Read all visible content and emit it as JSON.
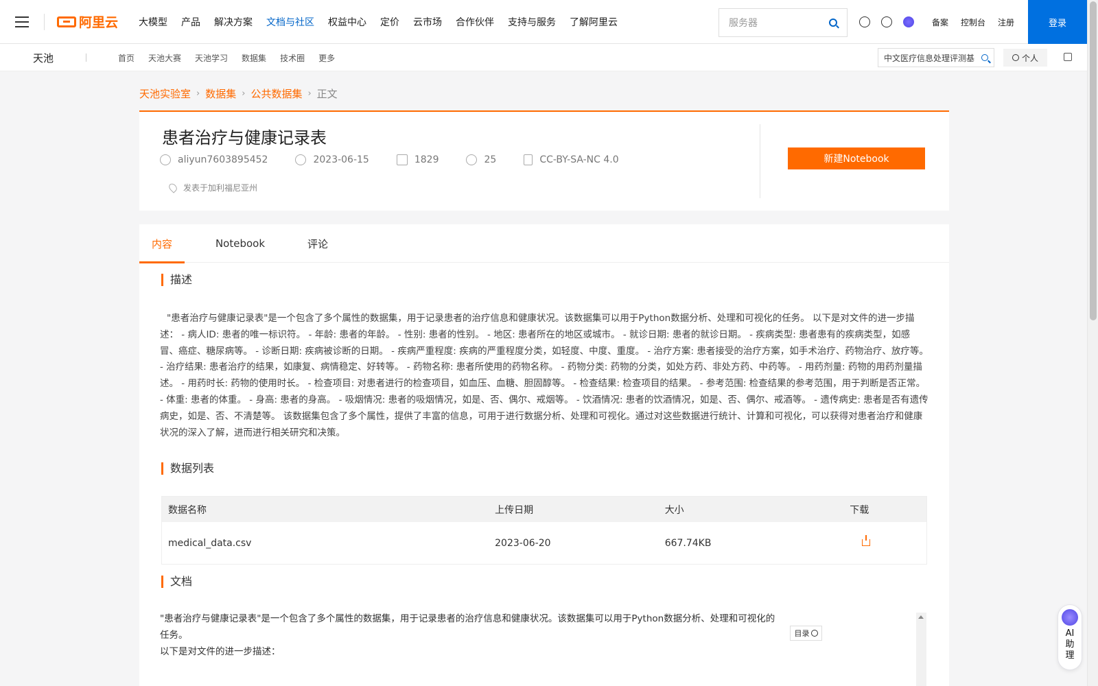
{
  "topnav": {
    "logo_text": "阿里云",
    "items": [
      "大模型",
      "产品",
      "解决方案",
      "文档与社区",
      "权益中心",
      "定价",
      "云市场",
      "合作伙伴",
      "支持与服务",
      "了解阿里云"
    ],
    "search_placeholder": "服务器",
    "links": [
      "备案",
      "控制台",
      "注册"
    ],
    "login": "登录"
  },
  "subnav": {
    "brand": "天池",
    "links": [
      "首页",
      "天池大赛",
      "天池学习",
      "数据集",
      "技术圈",
      "更多"
    ],
    "search_value": "中文医疗信息处理评测基",
    "personal": "个人"
  },
  "breadcrumb": [
    "天池实验室",
    "数据集",
    "公共数据集",
    "正文"
  ],
  "dataset": {
    "title": "患者治疗与健康记录表",
    "author": "aliyun7603895452",
    "date": "2023-06-15",
    "downloads": "1829",
    "citations": "25",
    "license": "CC-BY-SA-NC 4.0",
    "location": "发表于加利福尼亚州",
    "new_notebook": "新建Notebook"
  },
  "tabs": [
    "内容",
    "Notebook",
    "评论"
  ],
  "sections": {
    "description_title": "描述",
    "description": "\"患者治疗与健康记录表\"是一个包含了多个属性的数据集，用于记录患者的治疗信息和健康状况。该数据集可以用于Python数据分析、处理和可视化的任务。 以下是对文件的进一步描述： - 病人ID: 患者的唯一标识符。 - 年龄: 患者的年龄。 - 性别: 患者的性别。 - 地区: 患者所在的地区或城市。 - 就诊日期: 患者的就诊日期。 - 疾病类型: 患者患有的疾病类型，如感冒、癌症、糖尿病等。 - 诊断日期: 疾病被诊断的日期。 - 疾病严重程度: 疾病的严重程度分类，如轻度、中度、重度。 - 治疗方案: 患者接受的治疗方案，如手术治疗、药物治疗、放疗等。 - 治疗结果: 患者治疗的结果，如康复、病情稳定、好转等。 - 药物名称: 患者所使用的药物名称。 - 药物分类: 药物的分类，如处方药、非处方药、中药等。 - 用药剂量: 药物的用药剂量描述。 - 用药时长: 药物的使用时长。 - 检查项目: 对患者进行的检查项目，如血压、血糖、胆固醇等。 - 检查结果: 检查项目的结果。 - 参考范围: 检查结果的参考范围，用于判断是否正常。 - 体重: 患者的体重。 - 身高: 患者的身高。 - 吸烟情况: 患者的吸烟情况，如是、否、偶尔、戒烟等。 - 饮酒情况: 患者的饮酒情况，如是、否、偶尔、戒酒等。 - 遗传病史: 患者是否有遗传病史，如是、否、不清楚等。 该数据集包含了多个属性，提供了丰富的信息，可用于进行数据分析、处理和可视化。通过对这些数据进行统计、计算和可视化，可以获得对患者治疗和健康状况的深入了解，进而进行相关研究和决策。",
    "datalist_title": "数据列表",
    "table_headers": [
      "数据名称",
      "上传日期",
      "大小",
      "下载"
    ],
    "rows": [
      {
        "name": "medical_data.csv",
        "date": "2023-06-20",
        "size": "667.74KB"
      }
    ],
    "doc_title": "文档",
    "doc_line1": "\"患者治疗与健康记录表\"是一个包含了多个属性的数据集，用于记录患者的治疗信息和健康状况。该数据集可以用于Python数据分析、处理和可视化的任务。",
    "doc_line2": "以下是对文件的进一步描述：",
    "toc": "目录"
  },
  "ai_assistant": "AI助理",
  "colors": {
    "accent": "#ff6a00",
    "brand_blue": "#0070e0"
  }
}
